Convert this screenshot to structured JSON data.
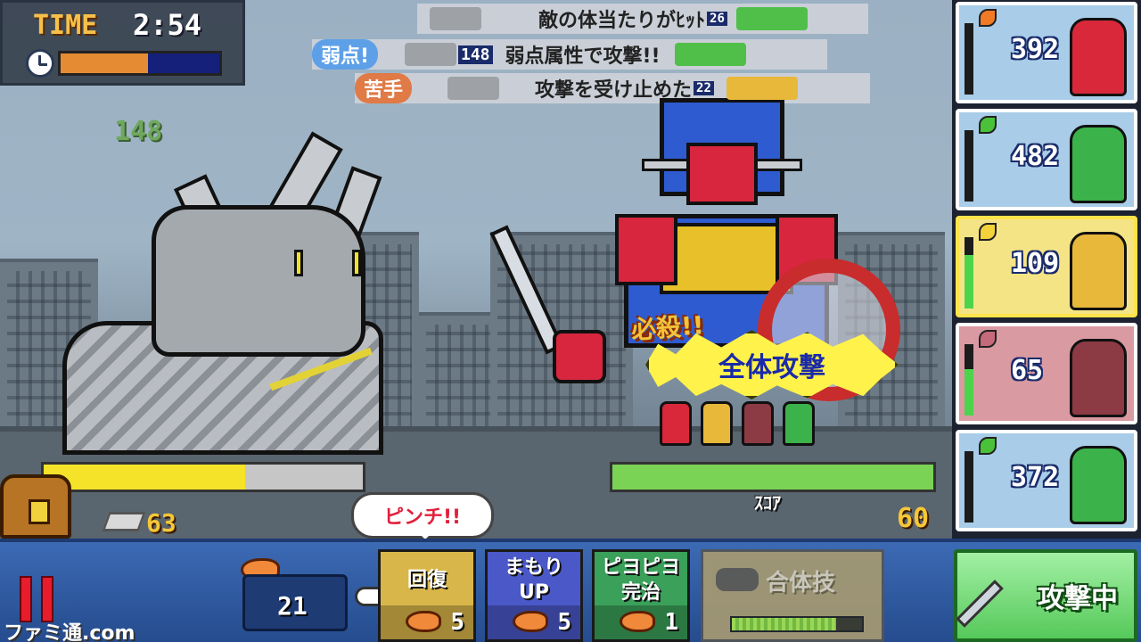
{
  "timer": {
    "label": "TIME",
    "value": "2:54",
    "progress": 0.55
  },
  "battle_log": [
    {
      "text": "敵の体当たりがﾋｯﾄ",
      "number": "26"
    },
    {
      "tag": "弱点!",
      "tag_color": "#5ea0e8",
      "pre_number": "148",
      "text": "弱点属性で攻撃!!"
    },
    {
      "tag": "苦手",
      "tag_color": "#e07a46",
      "text": "攻撃を受け止めた",
      "number": "22"
    }
  ],
  "floating_damage": "148",
  "special": {
    "callout": "必殺!!",
    "attack_name": "全体攻撃"
  },
  "enemy_hp": {
    "fraction": 0.63
  },
  "team_hp": {
    "fraction": 1.0,
    "label": "ｽｺｱ"
  },
  "score": "60",
  "ingots": "63",
  "pinch_message": "ピンチ!!",
  "team_cards": [
    {
      "element": "fire",
      "element_color": "#f07a26",
      "hp": "392",
      "bg": "#a9cde8",
      "portrait_color": "#d8283a",
      "gauge": 0.0
    },
    {
      "element": "leaf",
      "element_color": "#49c23a",
      "hp": "482",
      "bg": "#a9cde8",
      "portrait_color": "#3bb24a",
      "gauge": 0.0
    },
    {
      "element": "thunder",
      "element_color": "#f3d23a",
      "hp": "109",
      "bg": "#f5e486",
      "portrait_color": "#e8b83a",
      "gauge": 0.75,
      "selected": true
    },
    {
      "element": "dark",
      "element_color": "#c46a7a",
      "hp": "65",
      "bg": "#d99aa2",
      "portrait_color": "#8c3a44",
      "gauge": 0.65
    },
    {
      "element": "leaf",
      "element_color": "#49c23a",
      "hp": "372",
      "bg": "#a9cde8",
      "portrait_color": "#3bb24a",
      "gauge": 0.0
    }
  ],
  "commands": {
    "fish_total": "21",
    "heal": {
      "label": "回復",
      "cost": "5",
      "color": "#d9b64a"
    },
    "defense": {
      "line1": "まもり",
      "line2": "UP",
      "cost": "5",
      "color": "#4a58c8"
    },
    "cure": {
      "line1": "ピヨピヨ",
      "line2": "完治",
      "cost": "1",
      "color": "#3aa05a"
    },
    "combo": {
      "label": "合体技",
      "charge": 0.8
    },
    "attack": {
      "label": "攻撃中"
    }
  },
  "watermark": "ファミ通.com"
}
